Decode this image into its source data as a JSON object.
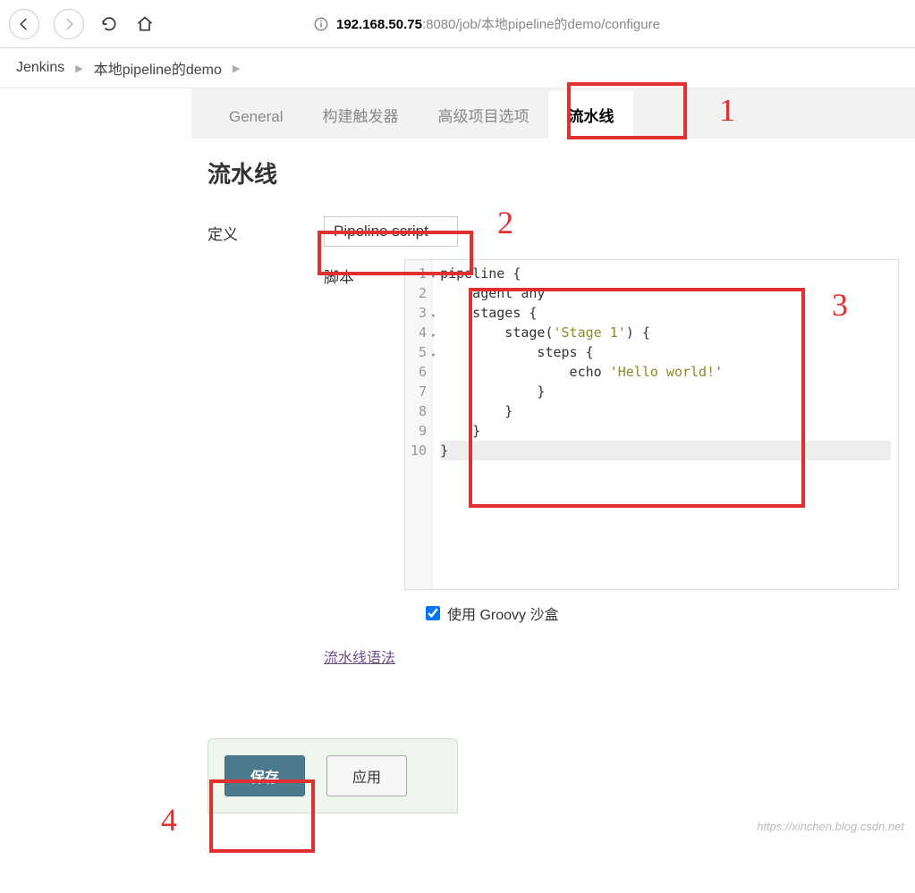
{
  "url": {
    "host_bold": "192.168.50.75",
    "port": ":8080",
    "path": "/job/本地pipeline的demo/configure"
  },
  "breadcrumbs": {
    "root": "Jenkins",
    "job": "本地pipeline的demo"
  },
  "tabs": {
    "general": "General",
    "triggers": "构建触发器",
    "advanced": "高级项目选项",
    "pipeline": "流水线"
  },
  "section": {
    "title": "流水线"
  },
  "definition": {
    "label": "定义",
    "value": "Pipeline script"
  },
  "script": {
    "label": "脚本",
    "lines": [
      "pipeline {",
      "    agent any",
      "    stages {",
      "        stage('Stage 1') {",
      "            steps {",
      "                echo 'Hello world!'",
      "            }",
      "        }",
      "    }",
      "}"
    ]
  },
  "sandbox": {
    "label": "使用 Groovy 沙盒",
    "checked": true
  },
  "syntax_link": "流水线语法",
  "buttons": {
    "save": "保存",
    "apply": "应用"
  },
  "annotations": {
    "a1": "1",
    "a2": "2",
    "a3": "3",
    "a4": "4"
  },
  "watermark": "https://xinchen.blog.csdn.net"
}
